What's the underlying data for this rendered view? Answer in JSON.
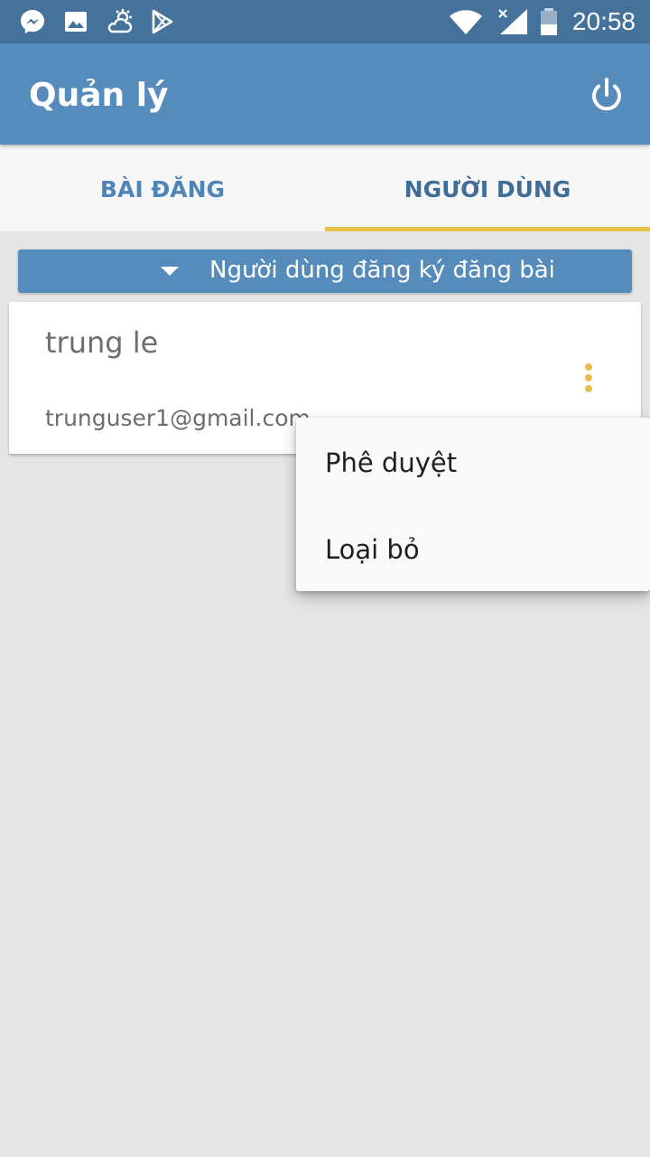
{
  "status_bar": {
    "time": "20:58",
    "notification_icons": [
      "messenger-icon",
      "image-icon",
      "weather-icon",
      "play-store-icon"
    ],
    "system_icons": [
      "wifi-icon",
      "signal-icon",
      "battery-icon"
    ]
  },
  "app_bar": {
    "title": "Quản lý",
    "action_icon": "power-icon",
    "background_color": "#568cbb"
  },
  "tabs": [
    {
      "label": "BÀI ĐĂNG",
      "active": false
    },
    {
      "label": "NGƯỜI DÙNG",
      "active": true
    }
  ],
  "tab_indicator_color": "#e8c24a",
  "filter": {
    "label": "Người dùng đăng ký đăng bài",
    "icon": "caret-down-icon"
  },
  "users": [
    {
      "name": "trung le",
      "email": "trunguser1@gmail.com"
    }
  ],
  "popup_menu": {
    "items": [
      {
        "label": "Phê duyệt"
      },
      {
        "label": "Loại bỏ"
      }
    ]
  }
}
